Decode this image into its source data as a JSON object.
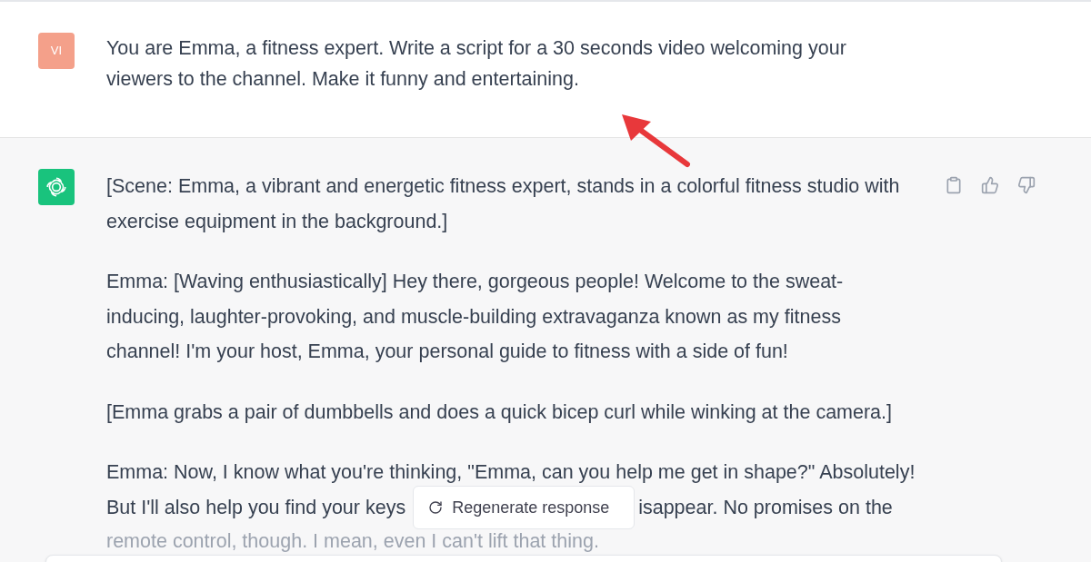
{
  "user_message": {
    "avatar": "VI",
    "text": "You are Emma, a fitness expert. Write a script for a 30 seconds video welcoming your viewers to the channel. Make it funny and entertaining."
  },
  "assistant_message": {
    "paragraphs": [
      {
        "lines": [
          {
            "text": "[Scene: Emma, a vibrant and energetic fitness expert, stands in a colorful fitness studio with exercise equipment in the background.]"
          }
        ]
      },
      {
        "lines": [
          {
            "text": "Emma: [Waving enthusiastically] Hey there, gorgeous people! Welcome to the sweat-inducing, laughter-provoking, and muscle-building extravaganza known as my fitness channel! I'm your host, Emma, your personal guide to fitness with a side of fun!"
          }
        ]
      },
      {
        "lines": [
          {
            "text": "[Emma grabs a pair of dumbbells and does a quick bicep curl while winking at the camera.]"
          }
        ]
      },
      {
        "lines": [
          {
            "text": "Emma: Now, I know what you're thinking, \"Emma, can you help me get in shape?\" Absolutely!"
          },
          {
            "text": "But I'll also help you find your keys",
            "after_button": "isappear. No promises on the"
          },
          {
            "text": "remote control, though. I mean, even I can't lift that thing.",
            "faded": true
          }
        ]
      }
    ]
  },
  "regenerate_button": {
    "label": "Regenerate response"
  }
}
